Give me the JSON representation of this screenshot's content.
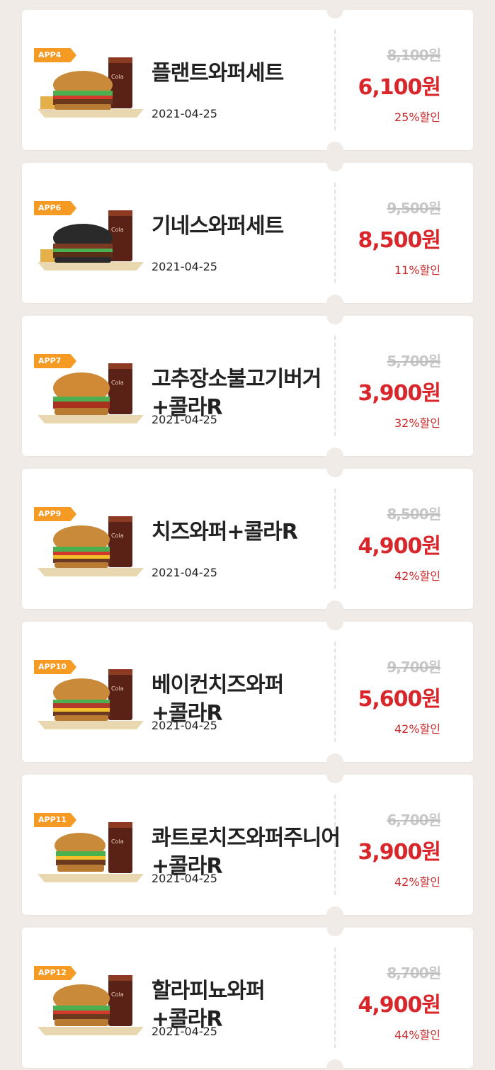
{
  "coupons": [
    {
      "badge": "APP4",
      "name": "플랜트와퍼세트",
      "date": "2021-04-25",
      "original_price": "8,100원",
      "sale_price": "6,100원",
      "discount": "25%할인",
      "bun": "#c98a3a"
    },
    {
      "badge": "APP6",
      "name": "기네스와퍼세트",
      "date": "2021-04-25",
      "original_price": "9,500원",
      "sale_price": "8,500원",
      "discount": "11%할인",
      "bun": "#2a2a2a"
    },
    {
      "badge": "APP7",
      "name": "고추장소불고기버거\n+콜라R",
      "date": "2021-04-25",
      "original_price": "5,700원",
      "sale_price": "3,900원",
      "discount": "32%할인",
      "bun": "#d08a35"
    },
    {
      "badge": "APP9",
      "name": "치즈와퍼+콜라R",
      "date": "2021-04-25",
      "original_price": "8,500원",
      "sale_price": "4,900원",
      "discount": "42%할인",
      "bun": "#c98a3a"
    },
    {
      "badge": "APP10",
      "name": "베이컨치즈와퍼\n+콜라R",
      "date": "2021-04-25",
      "original_price": "9,700원",
      "sale_price": "5,600원",
      "discount": "42%할인",
      "bun": "#c98a3a"
    },
    {
      "badge": "APP11",
      "name": "콰트로치즈와퍼주니어\n+콜라R",
      "date": "2021-04-25",
      "original_price": "6,700원",
      "sale_price": "3,900원",
      "discount": "42%할인",
      "bun": "#c98a3a"
    },
    {
      "badge": "APP12",
      "name": "할라피뇨와퍼\n+콜라R",
      "date": "2021-04-25",
      "original_price": "8,700원",
      "sale_price": "4,900원",
      "discount": "44%할인",
      "bun": "#c98a3a"
    }
  ],
  "colors": {
    "background": "#f1ebe7",
    "badge": "#f59a22",
    "sale_price": "#d9262b"
  },
  "icons": {
    "food": "burger-set-image"
  }
}
